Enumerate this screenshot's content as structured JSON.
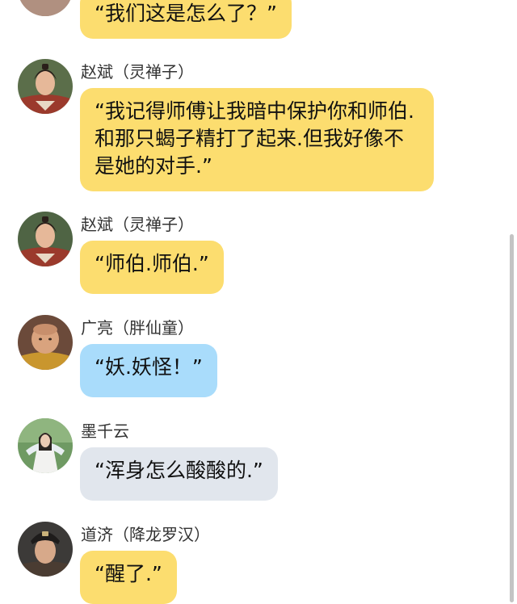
{
  "messages": [
    {
      "sender": "",
      "text": "“我们这是怎么了？”",
      "bubble_color": "#FCDD6F",
      "avatar": "avatar-photo"
    },
    {
      "sender": "赵斌（灵禅子）",
      "text": "“我记得师傅让我暗中保护你和师伯.和那只蝎子精打了起来.但我好像不是她的对手.”",
      "bubble_color": "#FCDD6F",
      "avatar": "avatar-photo"
    },
    {
      "sender": "赵斌（灵禅子）",
      "text": "“师伯.师伯.”",
      "bubble_color": "#FCDD6F",
      "avatar": "avatar-photo"
    },
    {
      "sender": "广亮（胖仙童）",
      "text": "“妖.妖怪！”",
      "bubble_color": "#A9DCFB",
      "avatar": "avatar-photo"
    },
    {
      "sender": "墨千云",
      "text": "“浑身怎么酸酸的.”",
      "bubble_color": "#E1E6ED",
      "avatar": "avatar-photo"
    },
    {
      "sender": "道济（降龙罗汉）",
      "text": "“醒了.”",
      "bubble_color": "#FCDD6F",
      "avatar": "avatar-photo"
    }
  ]
}
